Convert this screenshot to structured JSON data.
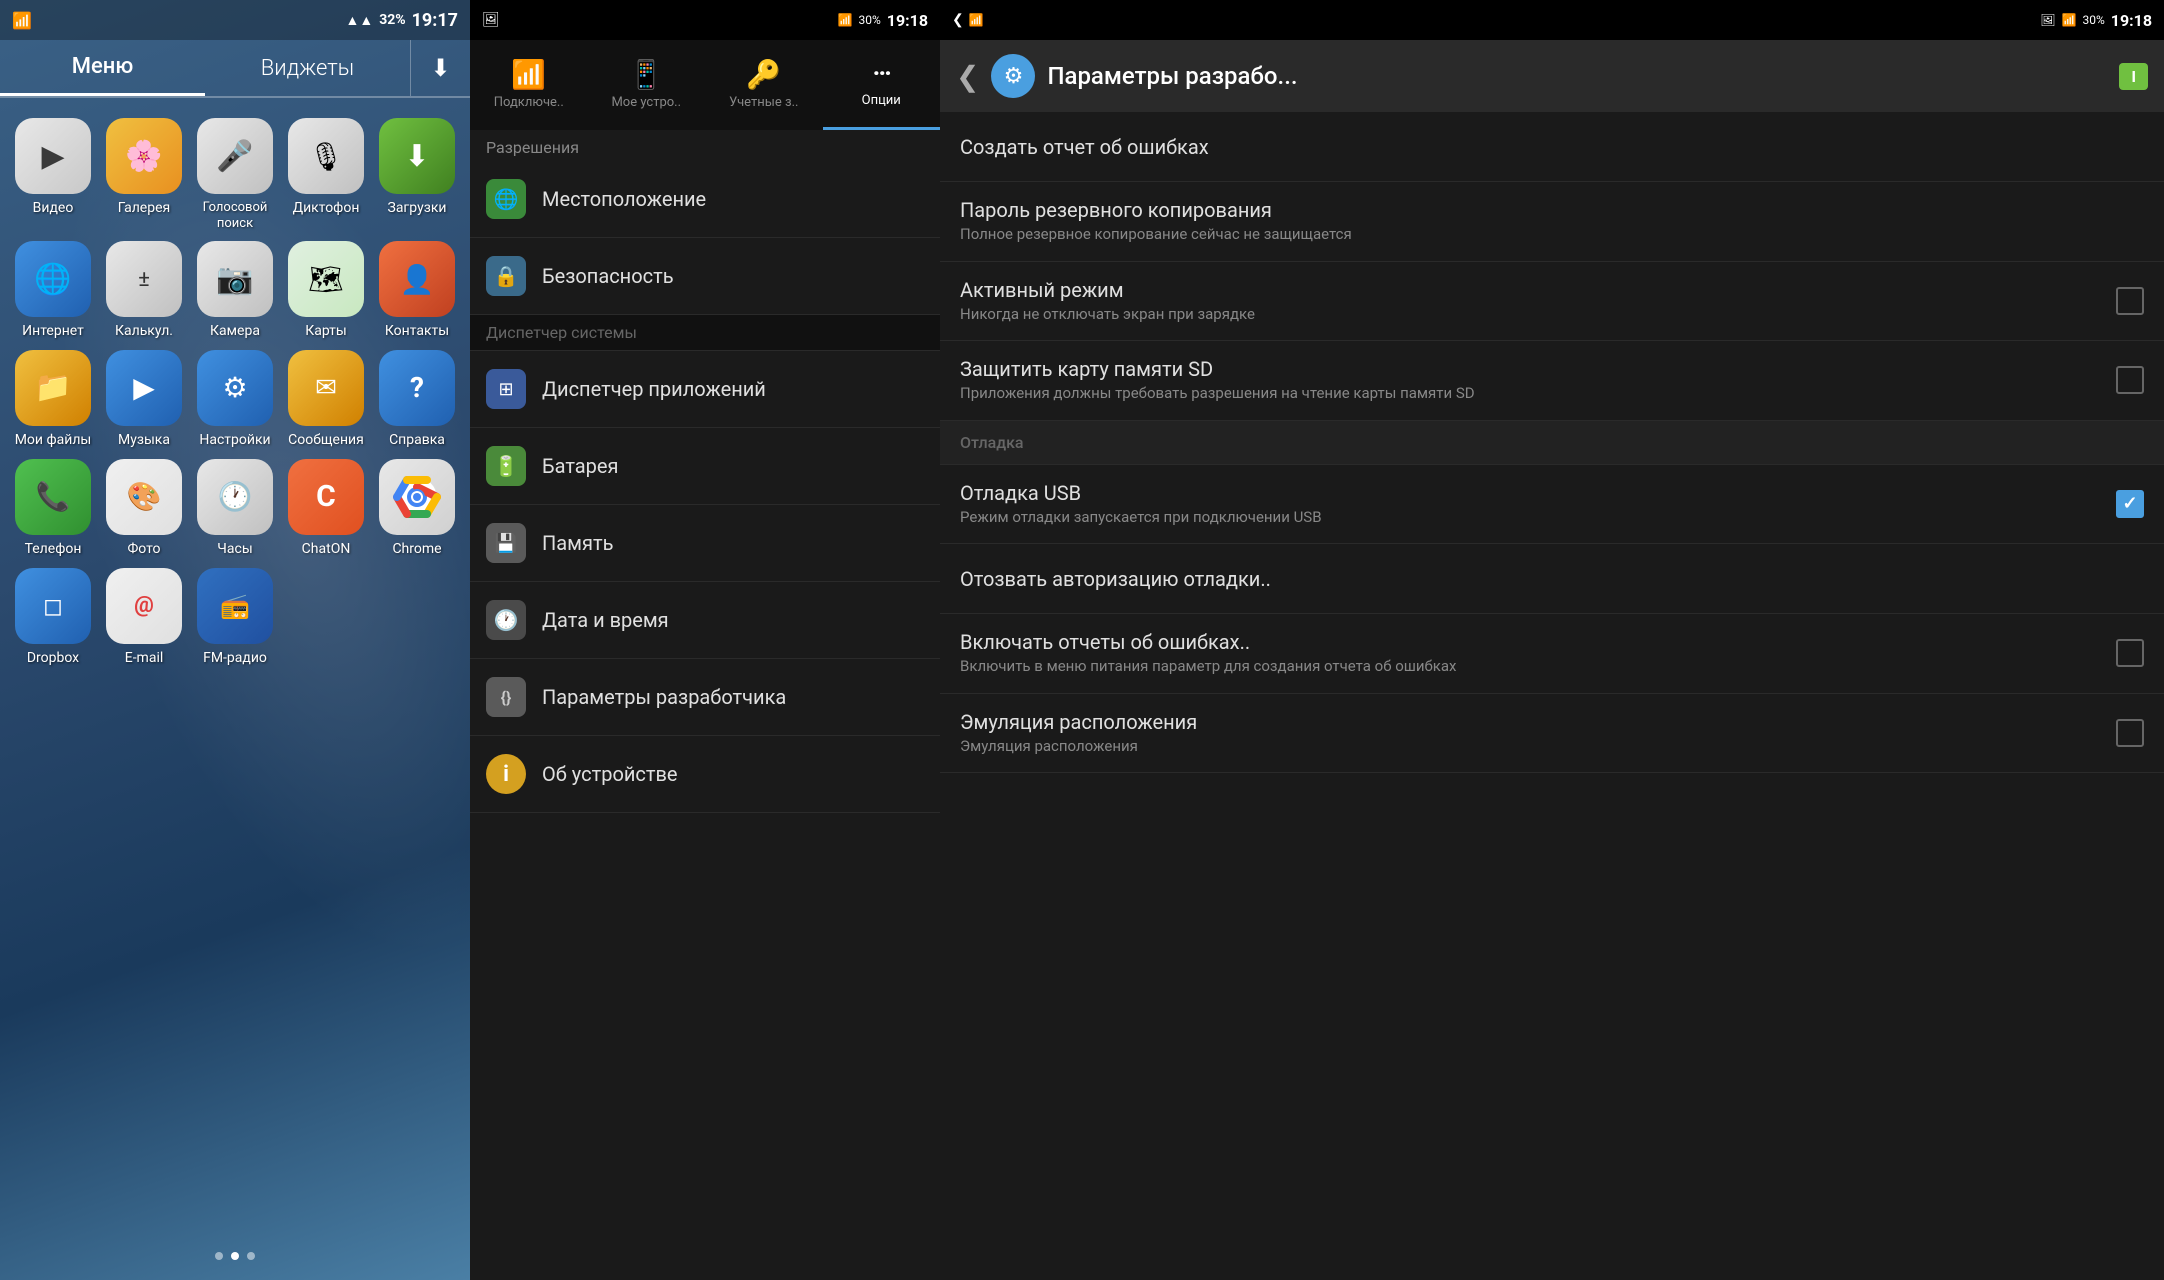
{
  "home": {
    "tabs": [
      {
        "label": "Меню",
        "active": true
      },
      {
        "label": "Виджеты",
        "active": false
      }
    ],
    "status": {
      "time": "19:17",
      "battery": "32%",
      "wifi": true
    },
    "apps": [
      {
        "id": "video",
        "label": "Видео",
        "icon": "▶",
        "color": "ic-video"
      },
      {
        "id": "gallery",
        "label": "Галерея",
        "icon": "🌻",
        "color": "ic-gallery"
      },
      {
        "id": "voice",
        "label": "Голосовой поиск",
        "icon": "🎤",
        "color": "ic-voice"
      },
      {
        "id": "dictaphone",
        "label": "Диктофон",
        "icon": "🎙",
        "color": "ic-dictaphone"
      },
      {
        "id": "downloads",
        "label": "Загрузки",
        "icon": "⬇",
        "color": "ic-download"
      },
      {
        "id": "internet",
        "label": "Интернет",
        "icon": "🌐",
        "color": "ic-internet"
      },
      {
        "id": "calc",
        "label": "Калькул.",
        "icon": "±",
        "color": "ic-calc"
      },
      {
        "id": "camera",
        "label": "Камера",
        "icon": "📷",
        "color": "ic-camera"
      },
      {
        "id": "maps",
        "label": "Карты",
        "icon": "🗺",
        "color": "ic-maps"
      },
      {
        "id": "contacts",
        "label": "Контакты",
        "icon": "👤",
        "color": "ic-contacts"
      },
      {
        "id": "files",
        "label": "Мои файлы",
        "icon": "📁",
        "color": "ic-files"
      },
      {
        "id": "music",
        "label": "Музыка",
        "icon": "▶",
        "color": "ic-music"
      },
      {
        "id": "settings",
        "label": "Настройки",
        "icon": "⚙",
        "color": "ic-settings"
      },
      {
        "id": "messages",
        "label": "Сообщения",
        "icon": "✉",
        "color": "ic-messages"
      },
      {
        "id": "help",
        "label": "Справка",
        "icon": "?",
        "color": "ic-help"
      },
      {
        "id": "phone",
        "label": "Телефон",
        "icon": "📞",
        "color": "ic-phone"
      },
      {
        "id": "photos",
        "label": "Фото",
        "icon": "🎨",
        "color": "ic-photos"
      },
      {
        "id": "clock",
        "label": "Часы",
        "icon": "🕐",
        "color": "ic-clock"
      },
      {
        "id": "chaton",
        "label": "ChatON",
        "icon": "C",
        "color": "ic-chaton"
      },
      {
        "id": "chrome",
        "label": "Chrome",
        "icon": "◎",
        "color": "ic-chrome"
      },
      {
        "id": "dropbox",
        "label": "Dropbox",
        "icon": "◻",
        "color": "ic-dropbox"
      },
      {
        "id": "email",
        "label": "E-mail",
        "icon": "@",
        "color": "ic-email"
      },
      {
        "id": "fmradio",
        "label": "FM-радио",
        "icon": "📻",
        "color": "ic-fmradio"
      }
    ],
    "dots": [
      {
        "active": false
      },
      {
        "active": true
      },
      {
        "active": false
      }
    ]
  },
  "settings": {
    "status": {
      "time": "19:18",
      "battery": "30%"
    },
    "tabs": [
      {
        "id": "connect",
        "label": "Подключе..",
        "icon": "📶",
        "active": false
      },
      {
        "id": "device",
        "label": "Мое устро..",
        "icon": "📱",
        "active": false
      },
      {
        "id": "accounts",
        "label": "Учетные з..",
        "icon": "🔑",
        "active": false
      },
      {
        "id": "options",
        "label": "Опции",
        "icon": "···",
        "active": true
      }
    ],
    "section": "Разрешения",
    "items": [
      {
        "id": "location",
        "label": "Местоположение",
        "icon": "🌐",
        "iconBg": "#3a8a3a"
      },
      {
        "id": "security",
        "label": "Безопасность",
        "icon": "🔒",
        "iconBg": "#3a6a8a"
      },
      {
        "id": "sysmanager",
        "label": "Диспетчер системы",
        "isSection": true
      },
      {
        "id": "appmanager",
        "label": "Диспетчер приложений",
        "icon": "⊞",
        "iconBg": "#3a5a9a"
      },
      {
        "id": "battery",
        "label": "Батарея",
        "icon": "🔋",
        "iconBg": "#5a9a3a"
      },
      {
        "id": "memory",
        "label": "Память",
        "icon": "💾",
        "iconBg": "#6a6a6a"
      },
      {
        "id": "datetime",
        "label": "Дата и время",
        "icon": "🕐",
        "iconBg": "#5a5a5a"
      },
      {
        "id": "developer",
        "label": "Параметры разработчика",
        "icon": "{}",
        "iconBg": "#5a5a5a"
      },
      {
        "id": "about",
        "label": "Об устройстве",
        "icon": "ℹ",
        "iconBg": "#d4a020"
      }
    ]
  },
  "developer": {
    "status": {
      "time": "19:18",
      "battery": "30%"
    },
    "header": {
      "title": "Параметры разрабо...",
      "back_icon": "❮",
      "settings_icon": "⚙",
      "battery_label": "I"
    },
    "items": [
      {
        "id": "bug-report",
        "title": "Создать отчет об ошибках",
        "subtitle": "",
        "hasCheckbox": false,
        "checked": false,
        "isSection": false
      },
      {
        "id": "backup-password",
        "title": "Пароль резервного копирования",
        "subtitle": "Полное резервное копирование сейчас не защищается",
        "hasCheckbox": false,
        "checked": false,
        "isSection": false
      },
      {
        "id": "stay-awake",
        "title": "Активный режим",
        "subtitle": "Никогда не отключать экран при зарядке",
        "hasCheckbox": true,
        "checked": false,
        "isSection": false
      },
      {
        "id": "protect-sd",
        "title": "Защитить карту памяти SD",
        "subtitle": "Приложения должны требовать разрешения на чтение карты памяти SD",
        "hasCheckbox": true,
        "checked": false,
        "isSection": false
      },
      {
        "id": "debug-section",
        "title": "Отладка",
        "subtitle": "",
        "hasCheckbox": false,
        "isSection": true
      },
      {
        "id": "usb-debug",
        "title": "Отладка USB",
        "subtitle": "Режим отладки запускается при подключении USB",
        "hasCheckbox": true,
        "checked": true,
        "isSection": false
      },
      {
        "id": "revoke-debug",
        "title": "Отозвать авторизацию отладки..",
        "subtitle": "",
        "hasCheckbox": false,
        "checked": false,
        "isSection": false
      },
      {
        "id": "bug-reports",
        "title": "Включать отчеты об ошибках..",
        "subtitle": "Включить в меню питания параметр для создания отчета об ошибках",
        "hasCheckbox": true,
        "checked": false,
        "isSection": false
      },
      {
        "id": "mock-location",
        "title": "Эмуляция расположения",
        "subtitle": "Эмуляция расположения",
        "hasCheckbox": true,
        "checked": false,
        "isSection": false
      }
    ]
  }
}
